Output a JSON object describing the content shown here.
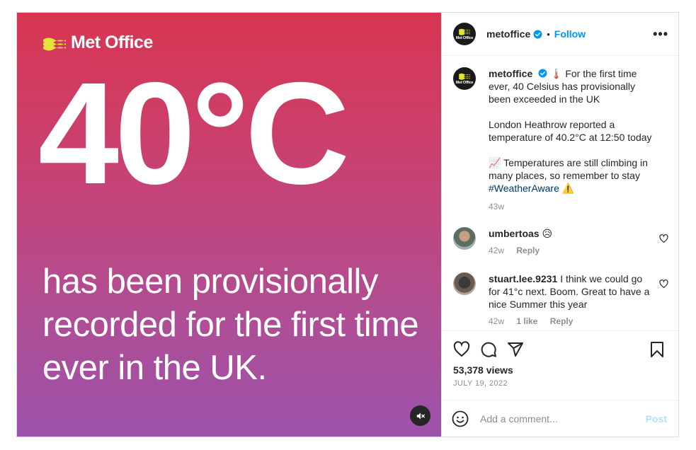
{
  "media": {
    "brand": "Met Office",
    "headline": "40°C",
    "subtext": "has been provisionally recorded for the first time ever in the UK."
  },
  "header": {
    "username": "metoffice",
    "separator": "•",
    "follow": "Follow",
    "more": "•••",
    "avatar_text": "Met Office"
  },
  "caption": {
    "username": "metoffice",
    "p1": "🌡️ For the first time ever, 40 Celsius has provisionally been exceeded in the UK",
    "p2": "London Heathrow reported a temperature of 40.2°C at 12:50 today",
    "p3": "📈 Temperatures are still climbing in many places, so remember to stay",
    "hashtag": "#WeatherAware",
    "p3_end": " ⚠️",
    "time": "43w"
  },
  "comments": [
    {
      "username": "umbertoas",
      "text": "😥",
      "time": "42w",
      "reply": "Reply"
    },
    {
      "username": "stuart.lee.9231",
      "text": "I think we could go for 41°c next. Boom. Great to have a nice Summer this year",
      "time": "42w",
      "likes": "1 like",
      "reply": "Reply"
    }
  ],
  "stats": {
    "views": "53,378 views",
    "date": "JULY 19, 2022"
  },
  "add_comment": {
    "placeholder": "Add a comment...",
    "post": "Post"
  },
  "colors": {
    "accent": "#0095f6",
    "gradient_top": "#d83551",
    "gradient_bottom": "#9c52ab",
    "brand_yellow": "#e5e23a"
  }
}
